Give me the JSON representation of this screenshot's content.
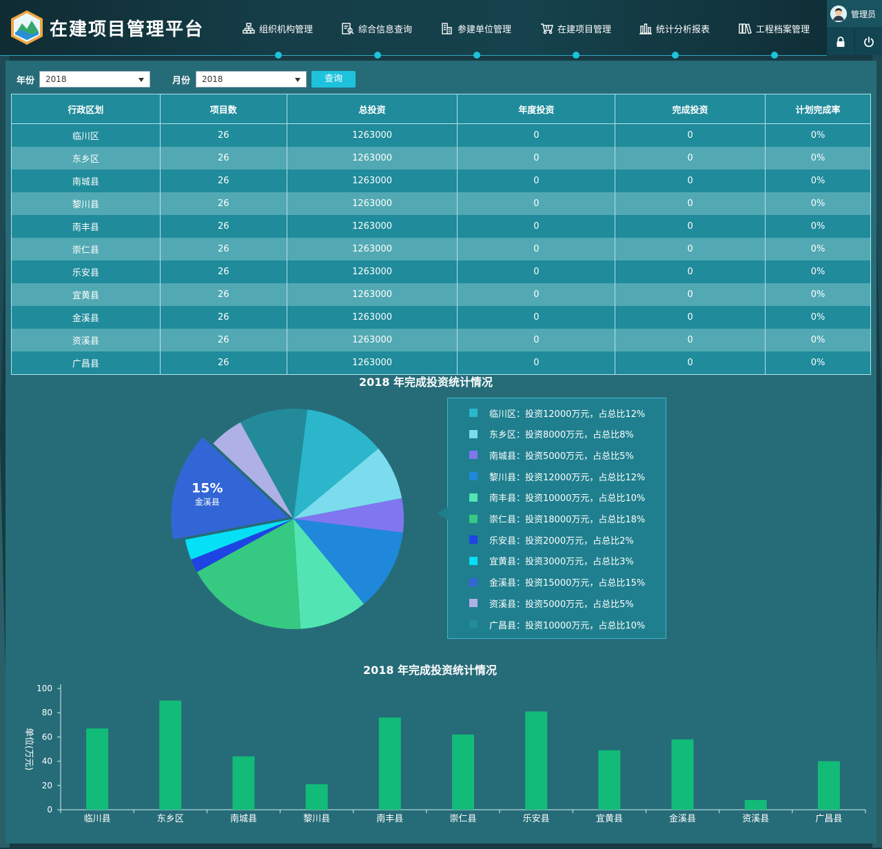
{
  "app": {
    "title": "在建项目管理平台"
  },
  "nav": [
    {
      "label": "组织机构管理",
      "icon": "org-chart-icon"
    },
    {
      "label": "综合信息查询",
      "icon": "document-search-icon"
    },
    {
      "label": "参建单位管理",
      "icon": "building-icon"
    },
    {
      "label": "在建项目管理",
      "icon": "cart-icon"
    },
    {
      "label": "统计分析报表",
      "icon": "bar-chart-icon"
    },
    {
      "label": "工程档案管理",
      "icon": "books-icon"
    }
  ],
  "user": {
    "name": "管理员",
    "lock_icon": "lock-icon",
    "power_icon": "power-icon"
  },
  "filters": {
    "year_label": "年份",
    "year_value": "2018",
    "month_label": "月份",
    "month_value": "2018",
    "query_label": "查询"
  },
  "table": {
    "headers": [
      "行政区划",
      "项目数",
      "总投资",
      "年度投资",
      "完成投资",
      "计划完成率"
    ],
    "rows": [
      [
        "临川区",
        "26",
        "1263000",
        "0",
        "0",
        "0%"
      ],
      [
        "东乡区",
        "26",
        "1263000",
        "0",
        "0",
        "0%"
      ],
      [
        "南城县",
        "26",
        "1263000",
        "0",
        "0",
        "0%"
      ],
      [
        "黎川县",
        "26",
        "1263000",
        "0",
        "0",
        "0%"
      ],
      [
        "南丰县",
        "26",
        "1263000",
        "0",
        "0",
        "0%"
      ],
      [
        "崇仁县",
        "26",
        "1263000",
        "0",
        "0",
        "0%"
      ],
      [
        "乐安县",
        "26",
        "1263000",
        "0",
        "0",
        "0%"
      ],
      [
        "宜黄县",
        "26",
        "1263000",
        "0",
        "0",
        "0%"
      ],
      [
        "金溪县",
        "26",
        "1263000",
        "0",
        "0",
        "0%"
      ],
      [
        "资溪县",
        "26",
        "1263000",
        "0",
        "0",
        "0%"
      ],
      [
        "广昌县",
        "26",
        "1263000",
        "0",
        "0",
        "0%"
      ]
    ]
  },
  "pie": {
    "title": "2018 年完成投资统计情况",
    "highlight_percent": "15%",
    "highlight_label": "金溪县",
    "legend": [
      {
        "text": "临川区：投资12000万元，占总比12%",
        "color": "#2bb6cc"
      },
      {
        "text": "东乡区：投资8000万元，占总比8%",
        "color": "#7adcec"
      },
      {
        "text": "南城县：投资5000万元，占总比5%",
        "color": "#8077f0"
      },
      {
        "text": "黎川县：投资12000万元，占总比12%",
        "color": "#1f88da"
      },
      {
        "text": "南丰县：投资10000万元，占总比10%",
        "color": "#52e5b3"
      },
      {
        "text": "崇仁县：投资18000万元，占总比18%",
        "color": "#36c981"
      },
      {
        "text": "乐安县：投资2000万元，占总比2%",
        "color": "#1e44e4"
      },
      {
        "text": "宜黄县：投资3000万元，占总比3%",
        "color": "#06e0f6"
      },
      {
        "text": "金溪县：投资15000万元，占总比15%",
        "color": "#3266d6"
      },
      {
        "text": "资溪县：投资5000万元，占总比5%",
        "color": "#afb0e6"
      },
      {
        "text": "广昌县：投资10000万元，占总比10%",
        "color": "#228a99"
      }
    ]
  },
  "chart_data": [
    {
      "type": "pie",
      "title": "2018 年完成投资统计情况",
      "categories": [
        "临川区",
        "东乡区",
        "南城县",
        "黎川县",
        "南丰县",
        "崇仁县",
        "乐安县",
        "宜黄县",
        "金溪县",
        "资溪县",
        "广昌县"
      ],
      "values": [
        12000,
        8000,
        5000,
        12000,
        10000,
        18000,
        2000,
        3000,
        15000,
        5000,
        10000
      ],
      "colors": [
        "#2bb6cc",
        "#7adcec",
        "#8077f0",
        "#1f88da",
        "#52e5b3",
        "#36c981",
        "#1e44e4",
        "#06e0f6",
        "#3266d6",
        "#afb0e6",
        "#228a99"
      ],
      "highlighted": "金溪县",
      "legend_position": "right"
    },
    {
      "type": "bar",
      "title": "2018 年完成投资统计情况",
      "ylabel": "单位(万元)",
      "xlabel": "",
      "ylim": [
        0,
        100
      ],
      "yticks": [
        0,
        20,
        40,
        60,
        80,
        100
      ],
      "categories": [
        "临川县",
        "东乡区",
        "南城县",
        "黎川县",
        "南丰县",
        "崇仁县",
        "乐安县",
        "宜黄县",
        "金溪县",
        "资溪县",
        "广昌县"
      ],
      "values": [
        67,
        90,
        44,
        21,
        76,
        62,
        81,
        49,
        58,
        8,
        40
      ],
      "color": "#12bb78",
      "grid": false
    }
  ]
}
